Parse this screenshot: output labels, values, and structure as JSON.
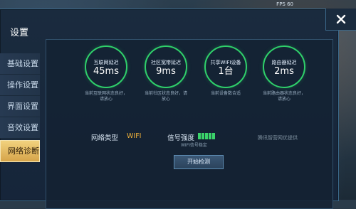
{
  "status": {
    "text": "FPS 60"
  },
  "header": {
    "title": "设置"
  },
  "sidebar": {
    "items": [
      {
        "label": "基础设置"
      },
      {
        "label": "操作设置"
      },
      {
        "label": "界面设置"
      },
      {
        "label": "音效设置"
      },
      {
        "label": "网络诊断"
      }
    ]
  },
  "metrics": [
    {
      "title": "互联网延迟",
      "value": "45ms",
      "desc": "当前互联网状态良好，请放心"
    },
    {
      "title": "社区宽带延迟",
      "value": "9ms",
      "desc": "当前社区状态良好，请放心"
    },
    {
      "title": "共享WIFI设备",
      "value": "1台",
      "desc": "当前设备数合适"
    },
    {
      "title": "路由器延迟",
      "value": "2ms",
      "desc": "当前路由器状态良好，请放心"
    }
  ],
  "network": {
    "type_label": "网络类型",
    "type_value": "WIFI",
    "signal_label": "信号强度",
    "signal_bars": 5,
    "signal_note": "WIFI信号稳定",
    "provider": "腾讯智营网优提供"
  },
  "actions": {
    "start_label": "开始检测"
  },
  "colors": {
    "accent": "#2fd06a",
    "active_tab": "#e6bd62",
    "wifi": "#f0b23a"
  }
}
